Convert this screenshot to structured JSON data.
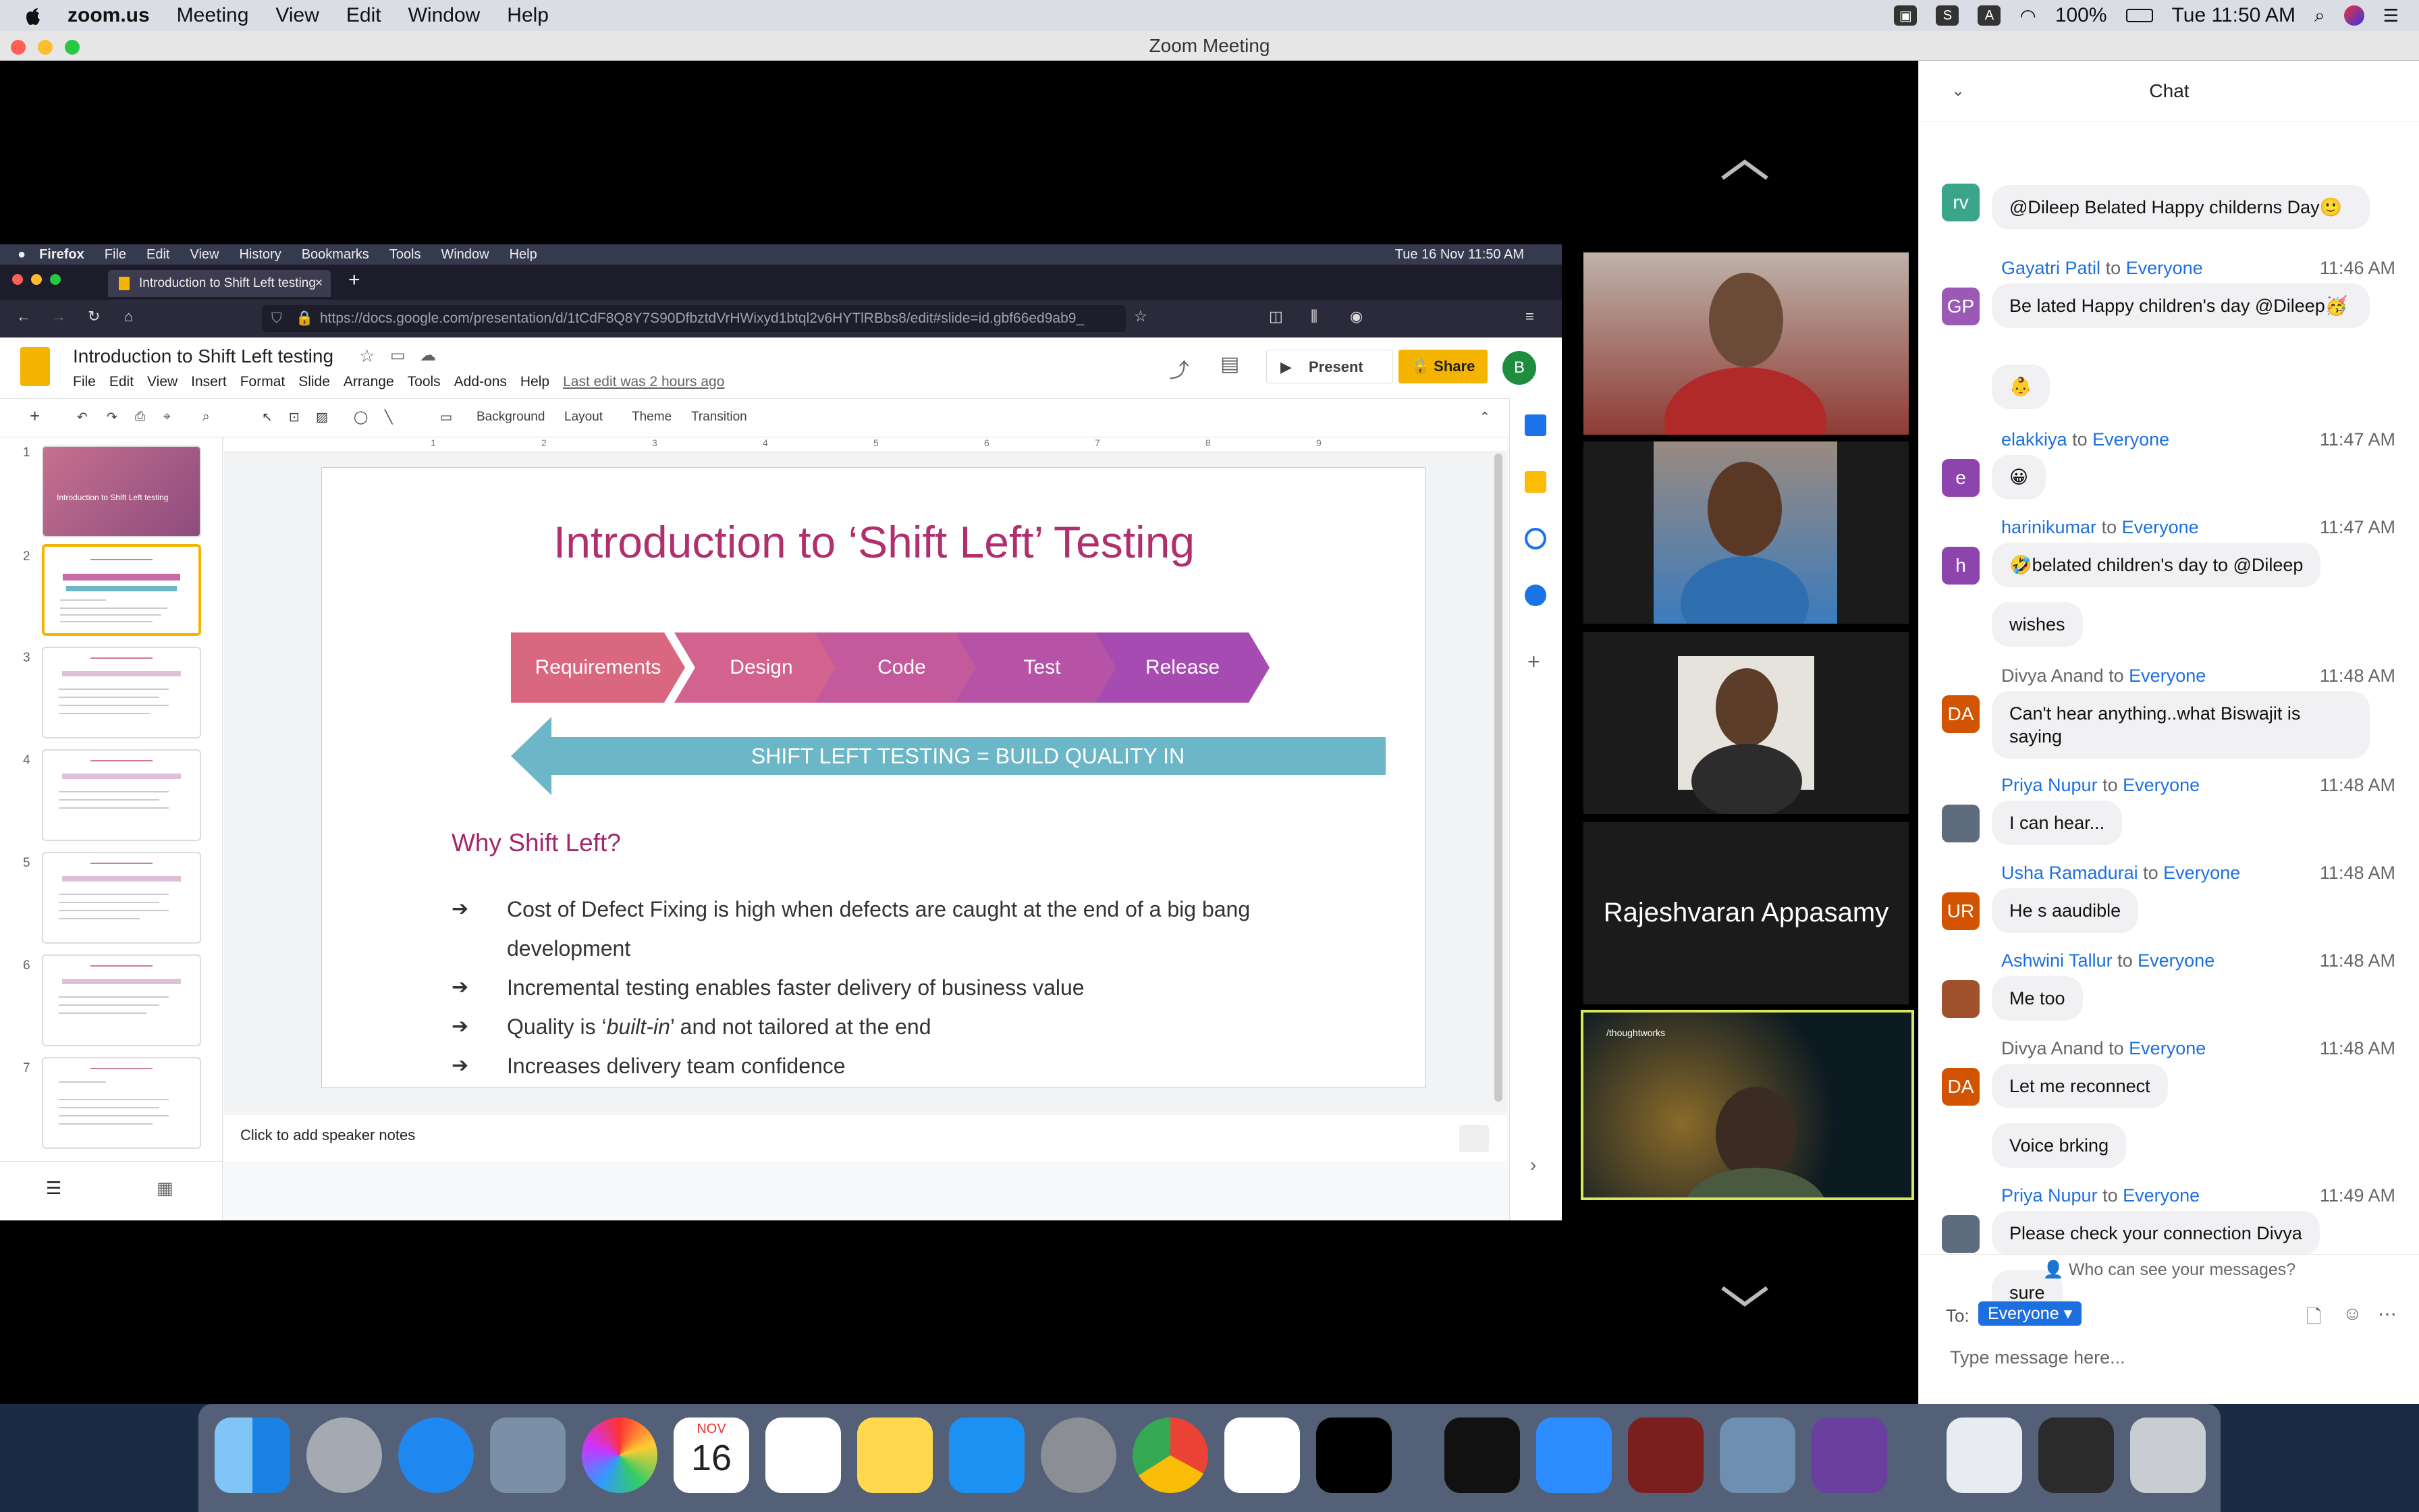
{
  "mac_menu": {
    "app": "zoom.us",
    "items": [
      "Meeting",
      "View",
      "Edit",
      "Window",
      "Help"
    ],
    "battery": "100%",
    "clock": "Tue 11:50 AM"
  },
  "zoom": {
    "window_title": "Zoom Meeting"
  },
  "firefox": {
    "menu": [
      "Firefox",
      "File",
      "Edit",
      "View",
      "History",
      "Bookmarks",
      "Tools",
      "Window",
      "Help"
    ],
    "clock": "Tue 16 Nov  11:50 AM",
    "tab_title": "Introduction to Shift Left testing",
    "url": "https://docs.google.com/presentation/d/1tCdF8Q8Y7S90DfbztdVrHWixyd1btql2v6HYTlRBbs8/edit#slide=id.gbf66ed9ab9_"
  },
  "slides": {
    "doc_title": "Introduction to Shift Left testing",
    "menu": [
      "File",
      "Edit",
      "View",
      "Insert",
      "Format",
      "Slide",
      "Arrange",
      "Tools",
      "Add-ons",
      "Help"
    ],
    "last_edit": "Last edit was 2 hours ago",
    "present_label": "Present",
    "share_label": "Share",
    "avatar": "B",
    "toolbar": {
      "background": "Background",
      "layout": "Layout",
      "theme": "Theme",
      "transition": "Transition"
    },
    "ruler": [
      "1",
      "2",
      "3",
      "4",
      "5",
      "6",
      "7",
      "8",
      "9"
    ],
    "thumb_numbers": [
      "1",
      "2",
      "3",
      "4",
      "5",
      "6",
      "7"
    ],
    "thumb1_title": "Introduction to Shift Left testing",
    "speaker_notes": "Click to add speaker notes"
  },
  "slide": {
    "title": "Introduction to ‘Shift Left’ Testing",
    "stages": [
      "Requirements",
      "Design",
      "Code",
      "Test",
      "Release"
    ],
    "stage_colors": [
      "#d9677f",
      "#d2628e",
      "#c45a9b",
      "#b653a7",
      "#a54bb1"
    ],
    "banner": "SHIFT LEFT TESTING = BUILD QUALITY IN",
    "subtitle": "Why Shift Left?",
    "bullets": {
      "b1": "Cost of Defect Fixing is high when defects are caught at the end of a big bang development",
      "b2": "Incremental testing enables faster delivery of business value",
      "b3_pre": "Quality is ‘",
      "b3_em": "built-in",
      "b3_post": "’ and not tailored at the end",
      "b4": "Increases delivery team confidence"
    }
  },
  "participants": {
    "name_tile": "Rajeshvaran Appasamy",
    "logo_text": "/thoughtworks"
  },
  "chat": {
    "title": "Chat",
    "to_word": "to",
    "messages": [
      {
        "initials": "rv",
        "color": "#3aa58a",
        "sender": "",
        "to": "",
        "time": "",
        "text": "@Dileep Belated Happy childerns Day🙂"
      },
      {
        "initials": "GP",
        "color": "#9b59b6",
        "sender": "Gayatri Patil",
        "to": "Everyone",
        "time": "11:46 AM",
        "text": "Be lated Happy children's day @Dileep🥳"
      },
      {
        "initials": "",
        "color": "",
        "sender": "",
        "to": "",
        "time": "",
        "text": "👶"
      },
      {
        "initials": "e",
        "color": "#8e44ad",
        "sender": "elakkiya",
        "to": "Everyone",
        "time": "11:47 AM",
        "text": "😀"
      },
      {
        "initials": "h",
        "color": "#8e44ad",
        "sender": "harinikumar",
        "to": "Everyone",
        "time": "11:47 AM",
        "text": "🤣belated children's day to @Dileep"
      },
      {
        "initials": "",
        "color": "",
        "sender": "",
        "to": "",
        "time": "",
        "text": "wishes"
      },
      {
        "initials": "DA",
        "color": "#d35400",
        "sender": "Divya Anand",
        "to": "Everyone",
        "time": "11:48 AM",
        "text": "Can't hear anything..what Biswajit is saying"
      },
      {
        "initials": "",
        "color": "#5d6d7e",
        "sender": "Priya Nupur",
        "to": "Everyone",
        "time": "11:48 AM",
        "text": "I can hear..."
      },
      {
        "initials": "UR",
        "color": "#d35400",
        "sender": "Usha Ramadurai",
        "to": "Everyone",
        "time": "11:48 AM",
        "text": "He s aaudible"
      },
      {
        "initials": "",
        "color": "#a0522d",
        "sender": "Ashwini Tallur",
        "to": "Everyone",
        "time": "11:48 AM",
        "text": "Me too"
      },
      {
        "initials": "DA",
        "color": "#d35400",
        "sender": "Divya Anand",
        "to": "Everyone",
        "time": "11:48 AM",
        "text": "Let me reconnect"
      },
      {
        "initials": "",
        "color": "",
        "sender": "",
        "to": "",
        "time": "",
        "text": "Voice brking"
      },
      {
        "initials": "",
        "color": "#5d6d7e",
        "sender": "Priya Nupur",
        "to": "Everyone",
        "time": "11:49 AM",
        "text": "Please check your connection Divya"
      },
      {
        "initials": "",
        "color": "",
        "sender": "",
        "to": "",
        "time": "",
        "text": "sure"
      }
    ],
    "who_can_see": "Who can see your messages?",
    "to_label": "To:",
    "recipient": "Everyone",
    "input_placeholder": "Type message here..."
  },
  "dock": {
    "calendar_month": "NOV",
    "calendar_day": "16"
  }
}
